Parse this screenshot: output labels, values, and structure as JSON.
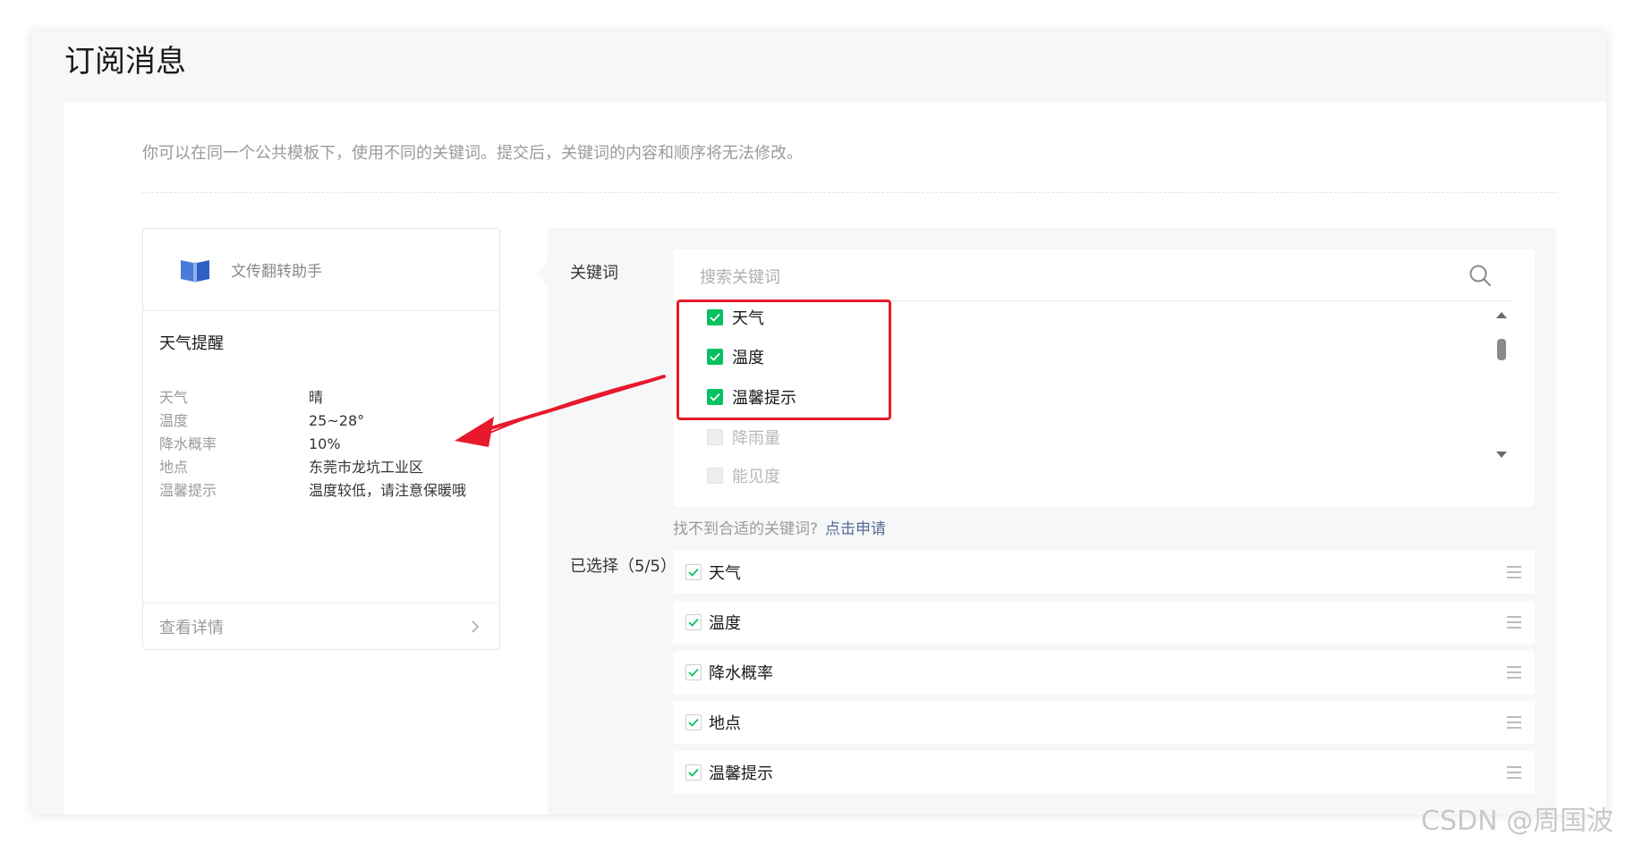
{
  "page": {
    "title": "订阅消息"
  },
  "notice": "你可以在同一个公共模板下，使用不同的关键词。提交后，关键词的内容和顺序将无法修改。",
  "preview": {
    "app_name": "文传翻转助手",
    "title": "天气提醒",
    "fields": [
      {
        "label": "天气",
        "value": "晴"
      },
      {
        "label": "温度",
        "value": "25~28°"
      },
      {
        "label": "降水概率",
        "value": "10%"
      },
      {
        "label": "地点",
        "value": "东莞市龙坑工业区"
      },
      {
        "label": "温馨提示",
        "value": "温度较低，请注意保暖哦"
      }
    ],
    "footer_label": "查看详情"
  },
  "keywords": {
    "label": "关键词",
    "search_placeholder": "搜索关键词",
    "items": [
      {
        "label": "天气",
        "checked": true
      },
      {
        "label": "温度",
        "checked": true
      },
      {
        "label": "温馨提示",
        "checked": true
      },
      {
        "label": "降雨量",
        "checked": false
      },
      {
        "label": "能见度",
        "checked": false
      }
    ],
    "missing_text": "找不到合适的关键词?",
    "apply_link": "点击申请"
  },
  "selected": {
    "label": "已选择（5/5）",
    "items": [
      "天气",
      "温度",
      "降水概率",
      "地点",
      "温馨提示"
    ]
  },
  "colors": {
    "accent_green": "#07c160",
    "link_blue": "#576b95",
    "annotation_red": "#e8192c"
  },
  "watermark": "CSDN @周国波"
}
